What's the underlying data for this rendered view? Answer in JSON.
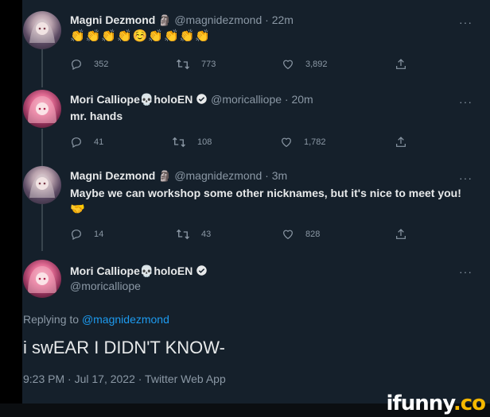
{
  "tweets": [
    {
      "name": "Magni Dezmond",
      "name_icon": "moai-emoji",
      "handle": "@magnidezmond",
      "time": "22m",
      "text": "👏👏👏👏☺️👏👏👏👏",
      "replies": "352",
      "retweets": "773",
      "likes": "3,892"
    },
    {
      "name": "Mori Calliope💀holoEN",
      "verified": true,
      "handle": "@moricalliope",
      "time": "20m",
      "text": "mr. hands",
      "replies": "41",
      "retweets": "108",
      "likes": "1,782"
    },
    {
      "name": "Magni Dezmond",
      "name_icon": "moai-emoji",
      "handle": "@magnidezmond",
      "time": "3m",
      "text": "Maybe we can workshop some other nicknames, but it's nice to meet you!",
      "text_emoji": "🤝",
      "replies": "14",
      "retweets": "43",
      "likes": "828"
    }
  ],
  "main_tweet": {
    "name": "Mori Calliope💀holoEN",
    "verified": true,
    "handle": "@moricalliope",
    "replying_to_label": "Replying to",
    "replying_to_handle": "@magnidezmond",
    "text": "i swEAR I DIDN'T KNOW-",
    "meta": "9:23 PM · Jul 17, 2022 · Twitter Web App"
  },
  "more_label": "···",
  "watermark": {
    "text": "ifunny",
    "dot": ".co"
  },
  "colors": {
    "background": "#15202b",
    "text": "#e7e9ea",
    "muted": "#8b98a5",
    "link": "#1d9bf0",
    "verified": "#1d9bf0"
  }
}
